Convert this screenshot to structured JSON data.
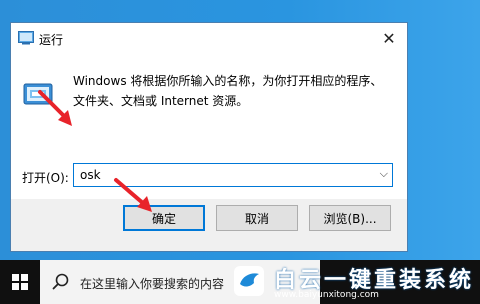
{
  "dialog": {
    "title": "运行",
    "description_line1": "Windows 将根据你所输入的名称，为你打开相应的程序、",
    "description_line2": "文件夹、文档或 Internet 资源。",
    "open_label": "打开(O):",
    "open_value": "osk",
    "ok_label": "确定",
    "cancel_label": "取消",
    "browse_label": "浏览(B)...",
    "close_glyph": "✕",
    "dropdown_glyph": "⌵"
  },
  "taskbar": {
    "search_placeholder": "在这里输入你要搜索的内容"
  },
  "watermark": {
    "name": "白云一键重装系统",
    "url": "www.baiyunxitong.com"
  },
  "colors": {
    "accent": "#0078d7",
    "arrow": "#e8232a",
    "desktop": "#2a93dd"
  }
}
